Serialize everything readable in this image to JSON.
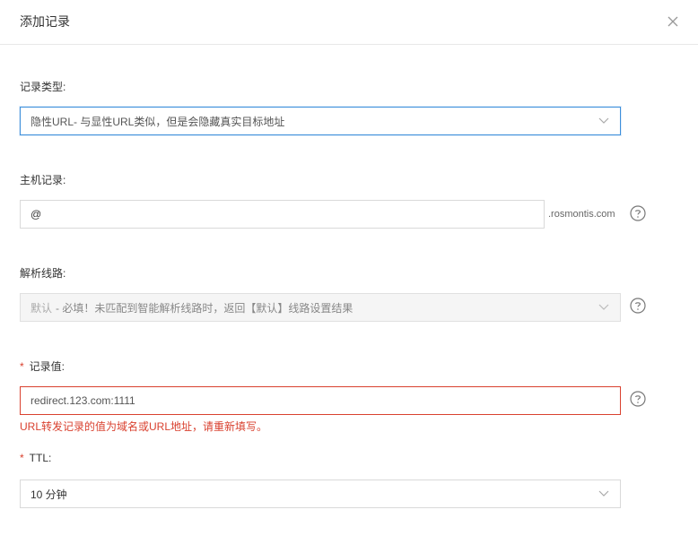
{
  "dialog": {
    "title": "添加记录"
  },
  "record_type": {
    "label": "记录类型:",
    "value": "隐性URL- 与显性URL类似，但是会隐藏真实目标地址"
  },
  "host": {
    "label": "主机记录:",
    "value": "@",
    "suffix": ".rosmontis.com"
  },
  "line": {
    "label": "解析线路:",
    "prefix": "默认",
    "value": " - 必填！未匹配到智能解析线路时，返回【默认】线路设置结果"
  },
  "record_value": {
    "required_mark": "*",
    "label": "记录值:",
    "value": "redirect.123.com:1111",
    "error": "URL转发记录的值为域名或URL地址，请重新填写。"
  },
  "ttl": {
    "required_mark": "*",
    "label": "TTL:",
    "value": "10 分钟"
  },
  "icons": {
    "close": "close-icon",
    "dropdown": "chevron-down-icon",
    "help": "help-circle-icon"
  },
  "colors": {
    "focus": "#3d8fdb",
    "error": "#d9412f"
  }
}
